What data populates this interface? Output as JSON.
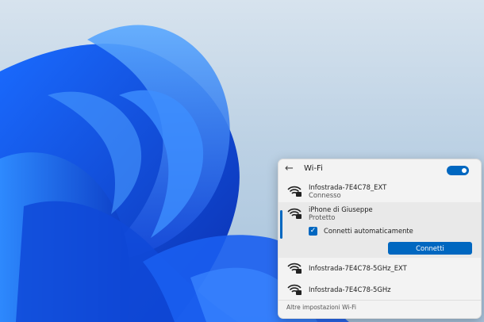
{
  "wifi_panel": {
    "title": "Wi-Fi",
    "toggle_state": "on",
    "networks": [
      {
        "name": "Infostrada-7E4C78_EXT",
        "status": "Connesso"
      },
      {
        "name": "iPhone di Giuseppe",
        "status": "Protetto",
        "auto_connect_label": "Connetti automaticamente",
        "auto_connect_checked": true,
        "connect_label": "Connetti"
      },
      {
        "name": "Infostrada-7E4C78-5GHz_EXT"
      },
      {
        "name": "Infostrada-7E4C78-5GHz"
      }
    ],
    "more_settings": "Altre impostazioni Wi-Fi"
  },
  "colors": {
    "accent": "#0067c0",
    "panel_bg": "#f3f3f3"
  },
  "icons": [
    "back-arrow-icon",
    "wifi-secured-icon",
    "checkmark-icon"
  ]
}
